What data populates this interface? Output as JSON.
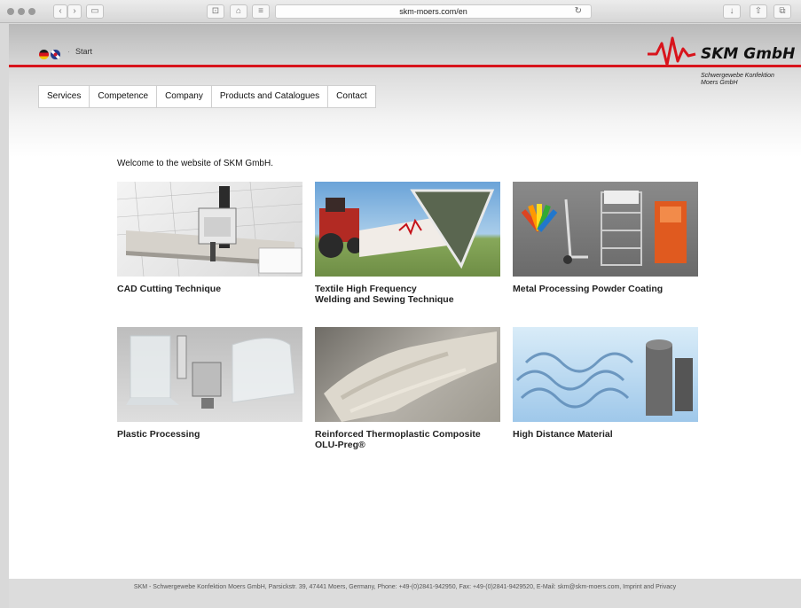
{
  "browser": {
    "url": "skm-moers.com/en",
    "reload_icon": "↻",
    "back_icon": "‹",
    "forward_icon": "›",
    "sidebar_icon": "▭",
    "download_icon": "↓",
    "share_icon": "⇧",
    "tabs_icon": "⧉"
  },
  "header": {
    "breadcrumb_separator": "·",
    "breadcrumb": "Start",
    "logo_title": "SKM GmbH",
    "logo_subtitle_line1": "Schwergewebe Konfektion",
    "logo_subtitle_line2": "Moers GmbH",
    "brand_color": "#d8141c"
  },
  "nav": {
    "items": [
      "Services",
      "Competence",
      "Company",
      "Products and Catalogues",
      "Contact"
    ]
  },
  "main": {
    "welcome": "Welcome to the website of SKM GmbH.",
    "cards": [
      {
        "title_line1": "CAD Cutting Technique",
        "title_line2": ""
      },
      {
        "title_line1": "Textile High Frequency",
        "title_line2": "Welding and Sewing Technique"
      },
      {
        "title_line1": "Metal Processing Powder Coating",
        "title_line2": ""
      },
      {
        "title_line1": "Plastic Processing",
        "title_line2": ""
      },
      {
        "title_line1": "Reinforced Thermoplastic Composite",
        "title_line2": "OLU-Preg®"
      },
      {
        "title_line1": "High Distance Material",
        "title_line2": ""
      }
    ]
  },
  "footer": {
    "text": "SKM - Schwergewebe Konfektion Moers GmbH, Parsickstr. 39, 47441 Moers, Germany, Phone: +49-(0)2841-942950, Fax: +49-(0)2841-9429520, E-Mail: skm@skm-moers.com, Imprint and Privacy"
  }
}
